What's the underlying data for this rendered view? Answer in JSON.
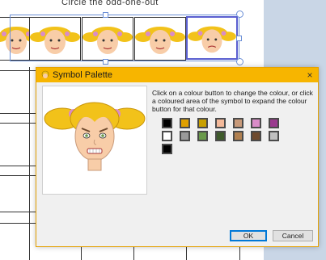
{
  "document": {
    "heading": "Circle   the   odd-one-out",
    "symbol_count": 5
  },
  "dialog": {
    "title": "Symbol Palette",
    "close_glyph": "×",
    "instructions": "Click on a colour button to change the colour, or click a coloured area of the symbol to expand the colour button for that colour.",
    "ok_label": "OK",
    "cancel_label": "Cancel",
    "swatch_rows": [
      [
        "#000000",
        "#e0a000",
        "#c8a000",
        "#f3b99a",
        "#c89a7a",
        "#d98cc8",
        "#9a3a8e"
      ],
      [
        "#ffffff",
        "#9a9a9a",
        "#6a9a4a",
        "#3e5a2a",
        "#b08050",
        "#6e4a2e",
        "#c0c0c0"
      ],
      [
        "#000000"
      ]
    ]
  },
  "colors": {
    "accent_orange": "#f7b500",
    "selection_blue": "#5a5fd0",
    "side_panel": "#c9d6e6"
  }
}
